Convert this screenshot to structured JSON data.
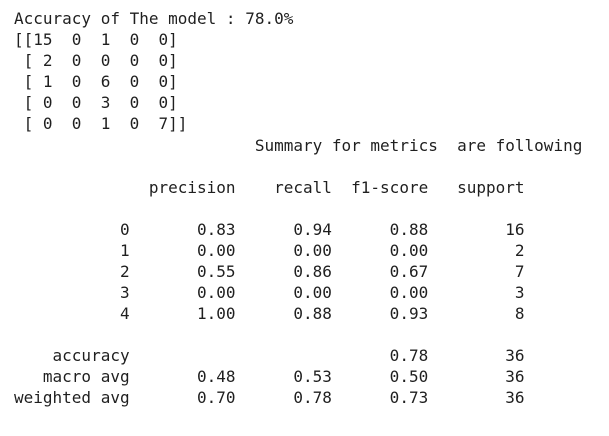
{
  "output": {
    "lines": [
      "Accuracy of The model : 78.0%",
      "[[15  0  1  0  0]",
      " [ 2  0  0  0  0]",
      " [ 1  0  6  0  0]",
      " [ 0  0  3  0  0]",
      " [ 0  0  1  0  7]]",
      "                         Summary for metrics  are following",
      "",
      "              precision    recall  f1-score   support",
      "",
      "           0       0.83      0.94      0.88        16",
      "           1       0.00      0.00      0.00         2",
      "           2       0.55      0.86      0.67         7",
      "           3       0.00      0.00      0.00         3",
      "           4       1.00      0.88      0.93         8",
      "",
      "    accuracy                           0.78        36",
      "   macro avg       0.48      0.53      0.50        36",
      "weighted avg       0.70      0.78      0.73        36"
    ]
  }
}
